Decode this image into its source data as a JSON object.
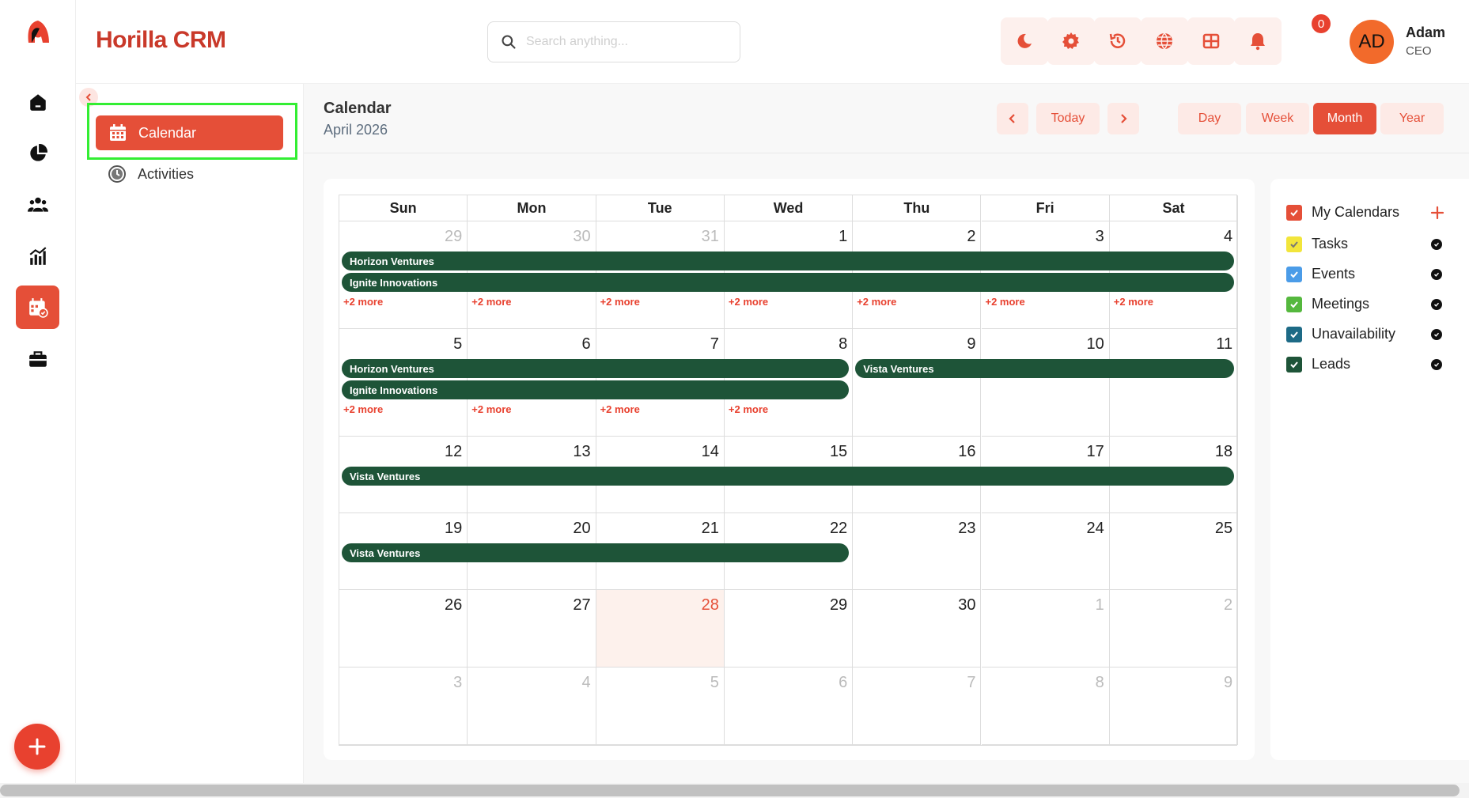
{
  "app": {
    "brand": "Horilla CRM"
  },
  "search": {
    "placeholder": "Search anything..."
  },
  "header": {
    "notification_count": "0"
  },
  "user": {
    "initials": "AD",
    "name": "Adam",
    "role": "CEO"
  },
  "subnav": {
    "items": [
      {
        "label": "Calendar"
      },
      {
        "label": "Activities"
      }
    ]
  },
  "calendar": {
    "title": "Calendar",
    "month_label": "April 2026",
    "today_label": "Today",
    "views": [
      "Day",
      "Week",
      "Month",
      "Year"
    ],
    "active_view": "Month",
    "weekdays": [
      "Sun",
      "Mon",
      "Tue",
      "Wed",
      "Thu",
      "Fri",
      "Sat"
    ],
    "more_label": "+2 more",
    "weeks": [
      [
        {
          "d": "29",
          "other": true
        },
        {
          "d": "30",
          "other": true
        },
        {
          "d": "31",
          "other": true
        },
        {
          "d": "1"
        },
        {
          "d": "2"
        },
        {
          "d": "3"
        },
        {
          "d": "4"
        }
      ],
      [
        {
          "d": "5"
        },
        {
          "d": "6"
        },
        {
          "d": "7"
        },
        {
          "d": "8"
        },
        {
          "d": "9"
        },
        {
          "d": "10"
        },
        {
          "d": "11"
        }
      ],
      [
        {
          "d": "12"
        },
        {
          "d": "13"
        },
        {
          "d": "14"
        },
        {
          "d": "15"
        },
        {
          "d": "16"
        },
        {
          "d": "17"
        },
        {
          "d": "18"
        }
      ],
      [
        {
          "d": "19"
        },
        {
          "d": "20"
        },
        {
          "d": "21"
        },
        {
          "d": "22"
        },
        {
          "d": "23"
        },
        {
          "d": "24"
        },
        {
          "d": "25"
        }
      ],
      [
        {
          "d": "26"
        },
        {
          "d": "27"
        },
        {
          "d": "28",
          "today": true
        },
        {
          "d": "29"
        },
        {
          "d": "30"
        },
        {
          "d": "1",
          "other": true
        },
        {
          "d": "2",
          "other": true
        }
      ],
      [
        {
          "d": "3",
          "other": true
        },
        {
          "d": "4",
          "other": true
        },
        {
          "d": "5",
          "other": true
        },
        {
          "d": "6",
          "other": true
        },
        {
          "d": "7",
          "other": true
        },
        {
          "d": "8",
          "other": true
        },
        {
          "d": "9",
          "other": true
        }
      ]
    ],
    "events": [
      {
        "title": "Horizon Ventures",
        "week": 0,
        "start": 0,
        "end": 6,
        "lane": 0
      },
      {
        "title": "Ignite Innovations",
        "week": 0,
        "start": 0,
        "end": 6,
        "lane": 1
      },
      {
        "title": "Horizon Ventures",
        "week": 1,
        "start": 0,
        "end": 3,
        "lane": 0
      },
      {
        "title": "Ignite Innovations",
        "week": 1,
        "start": 0,
        "end": 3,
        "lane": 1
      },
      {
        "title": "Vista Ventures",
        "week": 1,
        "start": 4,
        "end": 6,
        "lane": 0
      },
      {
        "title": "Vista Ventures",
        "week": 2,
        "start": 0,
        "end": 6,
        "lane": 0
      },
      {
        "title": "Vista Ventures",
        "week": 3,
        "start": 0,
        "end": 3,
        "lane": 0
      }
    ],
    "more": [
      {
        "week": 0,
        "days": [
          0,
          1,
          2,
          3,
          4,
          5,
          6
        ]
      },
      {
        "week": 1,
        "days": [
          0,
          1,
          2,
          3
        ]
      }
    ],
    "event_color": "#1e5438"
  },
  "my_calendars": {
    "title": "My Calendars",
    "items": [
      {
        "label": "Tasks",
        "color": "#f2e53b"
      },
      {
        "label": "Events",
        "color": "#4b9ce8"
      },
      {
        "label": "Meetings",
        "color": "#55b83e"
      },
      {
        "label": "Unavailability",
        "color": "#1d6a86"
      },
      {
        "label": "Leads",
        "color": "#1e5438"
      }
    ],
    "header_color": "#e54f38"
  },
  "colors": {
    "accent": "#e54f38",
    "brand": "#c9392a"
  }
}
